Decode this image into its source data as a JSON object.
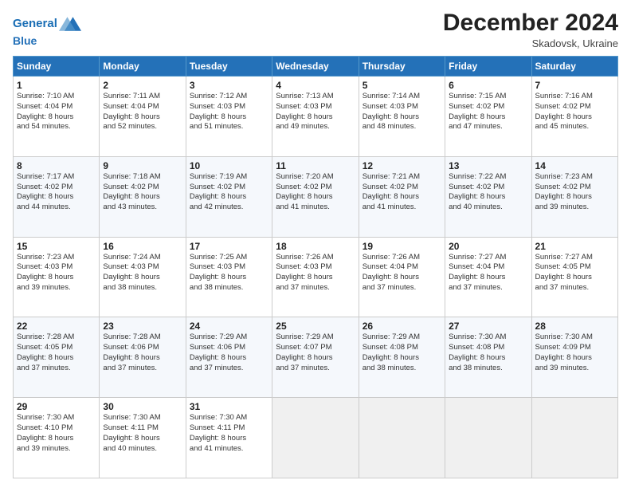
{
  "header": {
    "logo_line1": "General",
    "logo_line2": "Blue",
    "month_year": "December 2024",
    "location": "Skadovsk, Ukraine"
  },
  "weekdays": [
    "Sunday",
    "Monday",
    "Tuesday",
    "Wednesday",
    "Thursday",
    "Friday",
    "Saturday"
  ],
  "weeks": [
    [
      {
        "day": "1",
        "sunrise": "7:10 AM",
        "sunset": "4:04 PM",
        "daylight": "8 hours and 54 minutes."
      },
      {
        "day": "2",
        "sunrise": "7:11 AM",
        "sunset": "4:04 PM",
        "daylight": "8 hours and 52 minutes."
      },
      {
        "day": "3",
        "sunrise": "7:12 AM",
        "sunset": "4:03 PM",
        "daylight": "8 hours and 51 minutes."
      },
      {
        "day": "4",
        "sunrise": "7:13 AM",
        "sunset": "4:03 PM",
        "daylight": "8 hours and 49 minutes."
      },
      {
        "day": "5",
        "sunrise": "7:14 AM",
        "sunset": "4:03 PM",
        "daylight": "8 hours and 48 minutes."
      },
      {
        "day": "6",
        "sunrise": "7:15 AM",
        "sunset": "4:02 PM",
        "daylight": "8 hours and 47 minutes."
      },
      {
        "day": "7",
        "sunrise": "7:16 AM",
        "sunset": "4:02 PM",
        "daylight": "8 hours and 45 minutes."
      }
    ],
    [
      {
        "day": "8",
        "sunrise": "7:17 AM",
        "sunset": "4:02 PM",
        "daylight": "8 hours and 44 minutes."
      },
      {
        "day": "9",
        "sunrise": "7:18 AM",
        "sunset": "4:02 PM",
        "daylight": "8 hours and 43 minutes."
      },
      {
        "day": "10",
        "sunrise": "7:19 AM",
        "sunset": "4:02 PM",
        "daylight": "8 hours and 42 minutes."
      },
      {
        "day": "11",
        "sunrise": "7:20 AM",
        "sunset": "4:02 PM",
        "daylight": "8 hours and 41 minutes."
      },
      {
        "day": "12",
        "sunrise": "7:21 AM",
        "sunset": "4:02 PM",
        "daylight": "8 hours and 41 minutes."
      },
      {
        "day": "13",
        "sunrise": "7:22 AM",
        "sunset": "4:02 PM",
        "daylight": "8 hours and 40 minutes."
      },
      {
        "day": "14",
        "sunrise": "7:23 AM",
        "sunset": "4:02 PM",
        "daylight": "8 hours and 39 minutes."
      }
    ],
    [
      {
        "day": "15",
        "sunrise": "7:23 AM",
        "sunset": "4:03 PM",
        "daylight": "8 hours and 39 minutes."
      },
      {
        "day": "16",
        "sunrise": "7:24 AM",
        "sunset": "4:03 PM",
        "daylight": "8 hours and 38 minutes."
      },
      {
        "day": "17",
        "sunrise": "7:25 AM",
        "sunset": "4:03 PM",
        "daylight": "8 hours and 38 minutes."
      },
      {
        "day": "18",
        "sunrise": "7:26 AM",
        "sunset": "4:03 PM",
        "daylight": "8 hours and 37 minutes."
      },
      {
        "day": "19",
        "sunrise": "7:26 AM",
        "sunset": "4:04 PM",
        "daylight": "8 hours and 37 minutes."
      },
      {
        "day": "20",
        "sunrise": "7:27 AM",
        "sunset": "4:04 PM",
        "daylight": "8 hours and 37 minutes."
      },
      {
        "day": "21",
        "sunrise": "7:27 AM",
        "sunset": "4:05 PM",
        "daylight": "8 hours and 37 minutes."
      }
    ],
    [
      {
        "day": "22",
        "sunrise": "7:28 AM",
        "sunset": "4:05 PM",
        "daylight": "8 hours and 37 minutes."
      },
      {
        "day": "23",
        "sunrise": "7:28 AM",
        "sunset": "4:06 PM",
        "daylight": "8 hours and 37 minutes."
      },
      {
        "day": "24",
        "sunrise": "7:29 AM",
        "sunset": "4:06 PM",
        "daylight": "8 hours and 37 minutes."
      },
      {
        "day": "25",
        "sunrise": "7:29 AM",
        "sunset": "4:07 PM",
        "daylight": "8 hours and 37 minutes."
      },
      {
        "day": "26",
        "sunrise": "7:29 AM",
        "sunset": "4:08 PM",
        "daylight": "8 hours and 38 minutes."
      },
      {
        "day": "27",
        "sunrise": "7:30 AM",
        "sunset": "4:08 PM",
        "daylight": "8 hours and 38 minutes."
      },
      {
        "day": "28",
        "sunrise": "7:30 AM",
        "sunset": "4:09 PM",
        "daylight": "8 hours and 39 minutes."
      }
    ],
    [
      {
        "day": "29",
        "sunrise": "7:30 AM",
        "sunset": "4:10 PM",
        "daylight": "8 hours and 39 minutes."
      },
      {
        "day": "30",
        "sunrise": "7:30 AM",
        "sunset": "4:11 PM",
        "daylight": "8 hours and 40 minutes."
      },
      {
        "day": "31",
        "sunrise": "7:30 AM",
        "sunset": "4:11 PM",
        "daylight": "8 hours and 41 minutes."
      },
      null,
      null,
      null,
      null
    ]
  ]
}
